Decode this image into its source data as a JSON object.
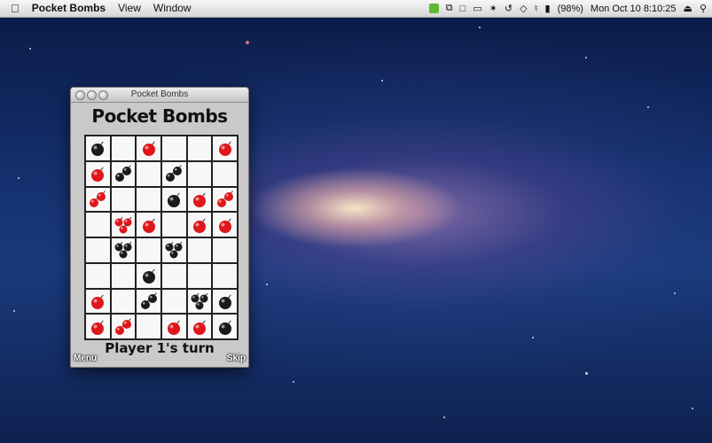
{
  "menubar": {
    "app_name": "Pocket Bombs",
    "menus": [
      "View",
      "Window"
    ],
    "battery": "(98%)",
    "clock": "Mon Oct 10  8:10:25"
  },
  "window": {
    "title": "Pocket Bombs",
    "logo": "Pocket Bombs",
    "turn_text": "Player 1's turn",
    "menu_button": "Menu",
    "skip_button": "Skip"
  },
  "game": {
    "player_colors": {
      "black": "#1a1a1a",
      "red": "#e0161b"
    },
    "board": [
      [
        {
          "c": "black",
          "n": 1
        },
        {
          "c": "",
          "n": 0
        },
        {
          "c": "red",
          "n": 1
        },
        {
          "c": "",
          "n": 0
        },
        {
          "c": "",
          "n": 0
        },
        {
          "c": "red",
          "n": 1
        }
      ],
      [
        {
          "c": "red",
          "n": 1
        },
        {
          "c": "black",
          "n": 2
        },
        {
          "c": "",
          "n": 0
        },
        {
          "c": "black",
          "n": 2
        },
        {
          "c": "",
          "n": 0
        },
        {
          "c": "",
          "n": 0
        }
      ],
      [
        {
          "c": "red",
          "n": 2
        },
        {
          "c": "",
          "n": 0
        },
        {
          "c": "",
          "n": 0
        },
        {
          "c": "black",
          "n": 1
        },
        {
          "c": "red",
          "n": 1
        },
        {
          "c": "red",
          "n": 2
        }
      ],
      [
        {
          "c": "",
          "n": 0
        },
        {
          "c": "red",
          "n": 3
        },
        {
          "c": "red",
          "n": 1
        },
        {
          "c": "",
          "n": 0
        },
        {
          "c": "red",
          "n": 1
        },
        {
          "c": "red",
          "n": 1
        }
      ],
      [
        {
          "c": "",
          "n": 0
        },
        {
          "c": "black",
          "n": 3
        },
        {
          "c": "",
          "n": 0
        },
        {
          "c": "black",
          "n": 3
        },
        {
          "c": "",
          "n": 0
        },
        {
          "c": "",
          "n": 0
        }
      ],
      [
        {
          "c": "",
          "n": 0
        },
        {
          "c": "",
          "n": 0
        },
        {
          "c": "black",
          "n": 1
        },
        {
          "c": "",
          "n": 0
        },
        {
          "c": "",
          "n": 0
        },
        {
          "c": "",
          "n": 0
        }
      ],
      [
        {
          "c": "red",
          "n": 1
        },
        {
          "c": "",
          "n": 0
        },
        {
          "c": "black",
          "n": 2
        },
        {
          "c": "",
          "n": 0
        },
        {
          "c": "black",
          "n": 3
        },
        {
          "c": "black",
          "n": 1
        }
      ],
      [
        {
          "c": "red",
          "n": 1
        },
        {
          "c": "red",
          "n": 2
        },
        {
          "c": "",
          "n": 0
        },
        {
          "c": "red",
          "n": 1
        },
        {
          "c": "red",
          "n": 1
        },
        {
          "c": "black",
          "n": 1
        }
      ]
    ]
  }
}
